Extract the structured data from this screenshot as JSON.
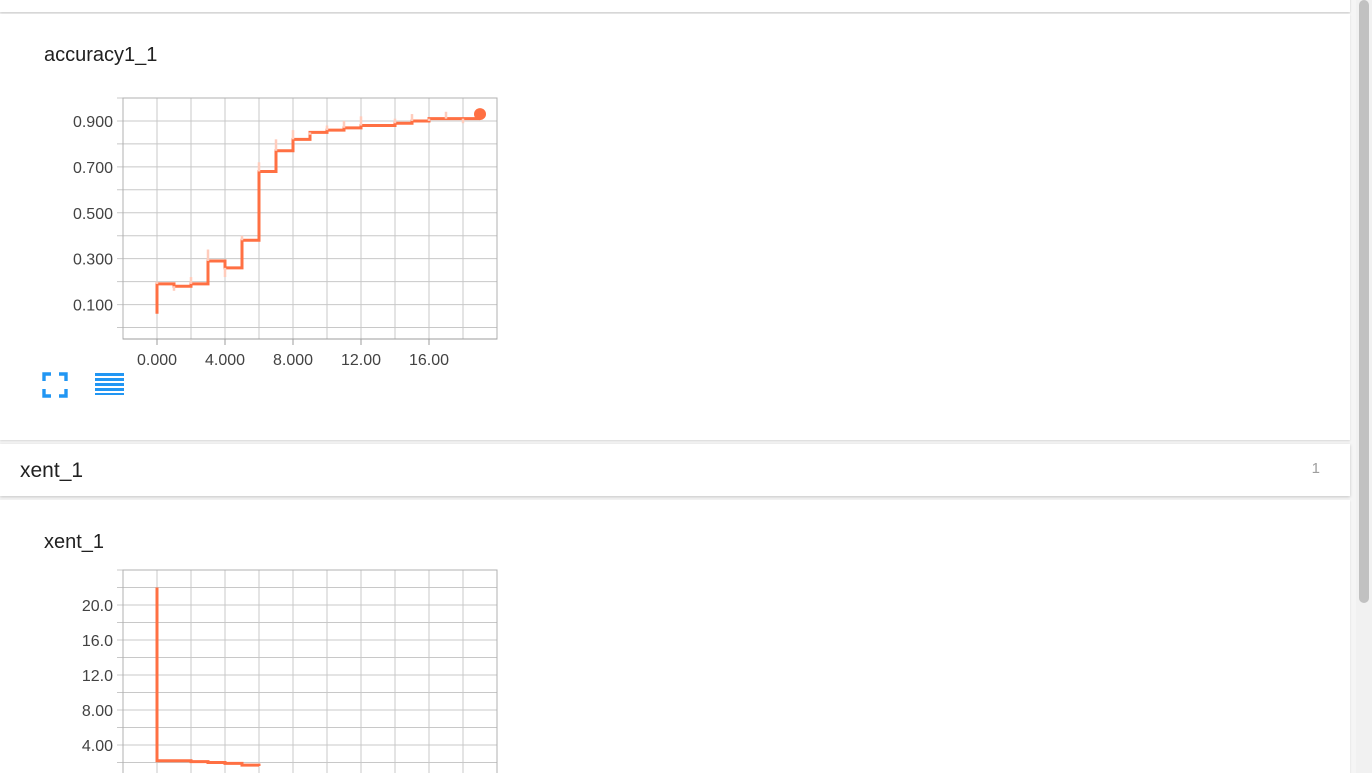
{
  "accuracy_card": {
    "title": "accuracy1_1"
  },
  "xent_section": {
    "title": "xent_1",
    "count": "1"
  },
  "xent_card": {
    "title": "xent_1"
  },
  "icons": {
    "fullscreen": "fullscreen-icon",
    "data_table": "data-table-icon"
  },
  "colors": {
    "series": "#ff7043",
    "series_raw": "#ffccbc",
    "grid": "#c8c8c8",
    "section_count": "#9e9e9e",
    "icon_accent": "#2196f3"
  },
  "chart_data": [
    {
      "type": "line",
      "title": "accuracy1_1",
      "xlabel": "",
      "ylabel": "",
      "xlim": [
        -2,
        20
      ],
      "ylim": [
        -0.05,
        1.0
      ],
      "xticks": [
        "0.000",
        "4.000",
        "8.000",
        "12.00",
        "16.00"
      ],
      "xtick_values": [
        0,
        4,
        8,
        12,
        16
      ],
      "yticks": [
        "0.900",
        "0.700",
        "0.500",
        "0.300",
        "0.100"
      ],
      "ytick_values": [
        0.9,
        0.7,
        0.5,
        0.3,
        0.1
      ],
      "grid": true,
      "series": [
        {
          "style": "smoothed-step",
          "x": [
            0,
            0,
            1,
            2,
            3,
            4,
            5,
            6,
            7,
            8,
            9,
            10,
            11,
            12,
            13,
            14,
            15,
            16,
            17,
            18,
            19
          ],
          "y": [
            0.06,
            0.19,
            0.18,
            0.19,
            0.29,
            0.26,
            0.38,
            0.68,
            0.77,
            0.82,
            0.85,
            0.86,
            0.87,
            0.88,
            0.88,
            0.89,
            0.9,
            0.91,
            0.91,
            0.91,
            0.91
          ]
        },
        {
          "style": "raw",
          "x": [
            0,
            1,
            2,
            3,
            4,
            5,
            6,
            7,
            8,
            9,
            10,
            11,
            12,
            13,
            14,
            15,
            16,
            17,
            18,
            19
          ],
          "y": [
            0.2,
            0.16,
            0.22,
            0.34,
            0.22,
            0.4,
            0.72,
            0.82,
            0.86,
            0.84,
            0.88,
            0.9,
            0.92,
            0.88,
            0.91,
            0.93,
            0.9,
            0.94,
            0.89,
            0.93
          ]
        }
      ],
      "last_point": {
        "x": 19,
        "y": 0.93
      }
    },
    {
      "type": "line",
      "title": "xent_1",
      "xlabel": "",
      "ylabel": "",
      "xlim": [
        -2,
        20
      ],
      "ylim": [
        0,
        24
      ],
      "yticks": [
        "20.0",
        "16.0",
        "12.0",
        "8.00",
        "4.00"
      ],
      "ytick_values": [
        20,
        16,
        12,
        8,
        4
      ],
      "grid": true,
      "series": [
        {
          "style": "smoothed-step",
          "x": [
            0,
            0,
            1,
            2,
            3,
            4,
            5,
            6
          ],
          "y": [
            22,
            2.2,
            2.2,
            2.1,
            2.0,
            1.9,
            1.7,
            1.6
          ]
        }
      ]
    }
  ]
}
